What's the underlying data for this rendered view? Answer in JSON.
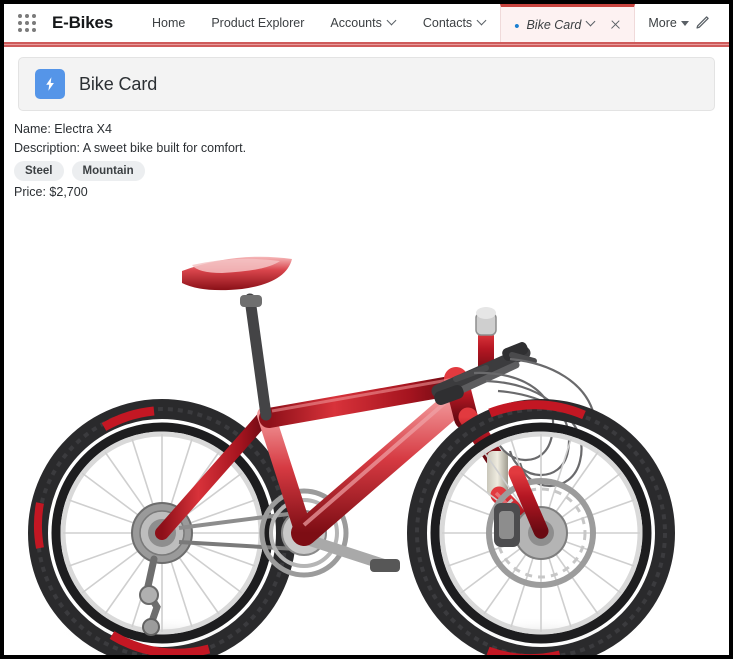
{
  "window": {
    "border_color": "#000000"
  },
  "global_nav": {
    "app_launcher_icon": "app-launcher-grid-icon",
    "app_name": "E-Bikes",
    "items": [
      {
        "label": "Home",
        "has_menu": false,
        "active": false
      },
      {
        "label": "Product Explorer",
        "has_menu": false,
        "active": false
      },
      {
        "label": "Accounts",
        "has_menu": true,
        "active": false
      },
      {
        "label": "Contacts",
        "has_menu": true,
        "active": false
      }
    ],
    "active_tab": {
      "label": "Bike Card",
      "unsaved_marker": "•",
      "has_menu": true,
      "closeable": true
    },
    "more_label": "More",
    "edit_icon": "pencil-icon",
    "accent_color": "#c8443f",
    "active_tab_bg": "#fdf2f2",
    "unsaved_dot_color": "#1b7fd1"
  },
  "card": {
    "icon_name": "lightning-bolt-icon",
    "icon_bg": "#5595e8",
    "title": "Bike Card"
  },
  "record": {
    "name_line": "Name: Electra X4",
    "description_line": "Description: A sweet bike built for comfort.",
    "tags": [
      "Steel",
      "Mountain"
    ],
    "price_line": "Price: $2,700"
  },
  "image": {
    "alt": "Red mountain bike product photo",
    "frame_color": "#b01622",
    "tire_color": "#2a2a2c"
  }
}
